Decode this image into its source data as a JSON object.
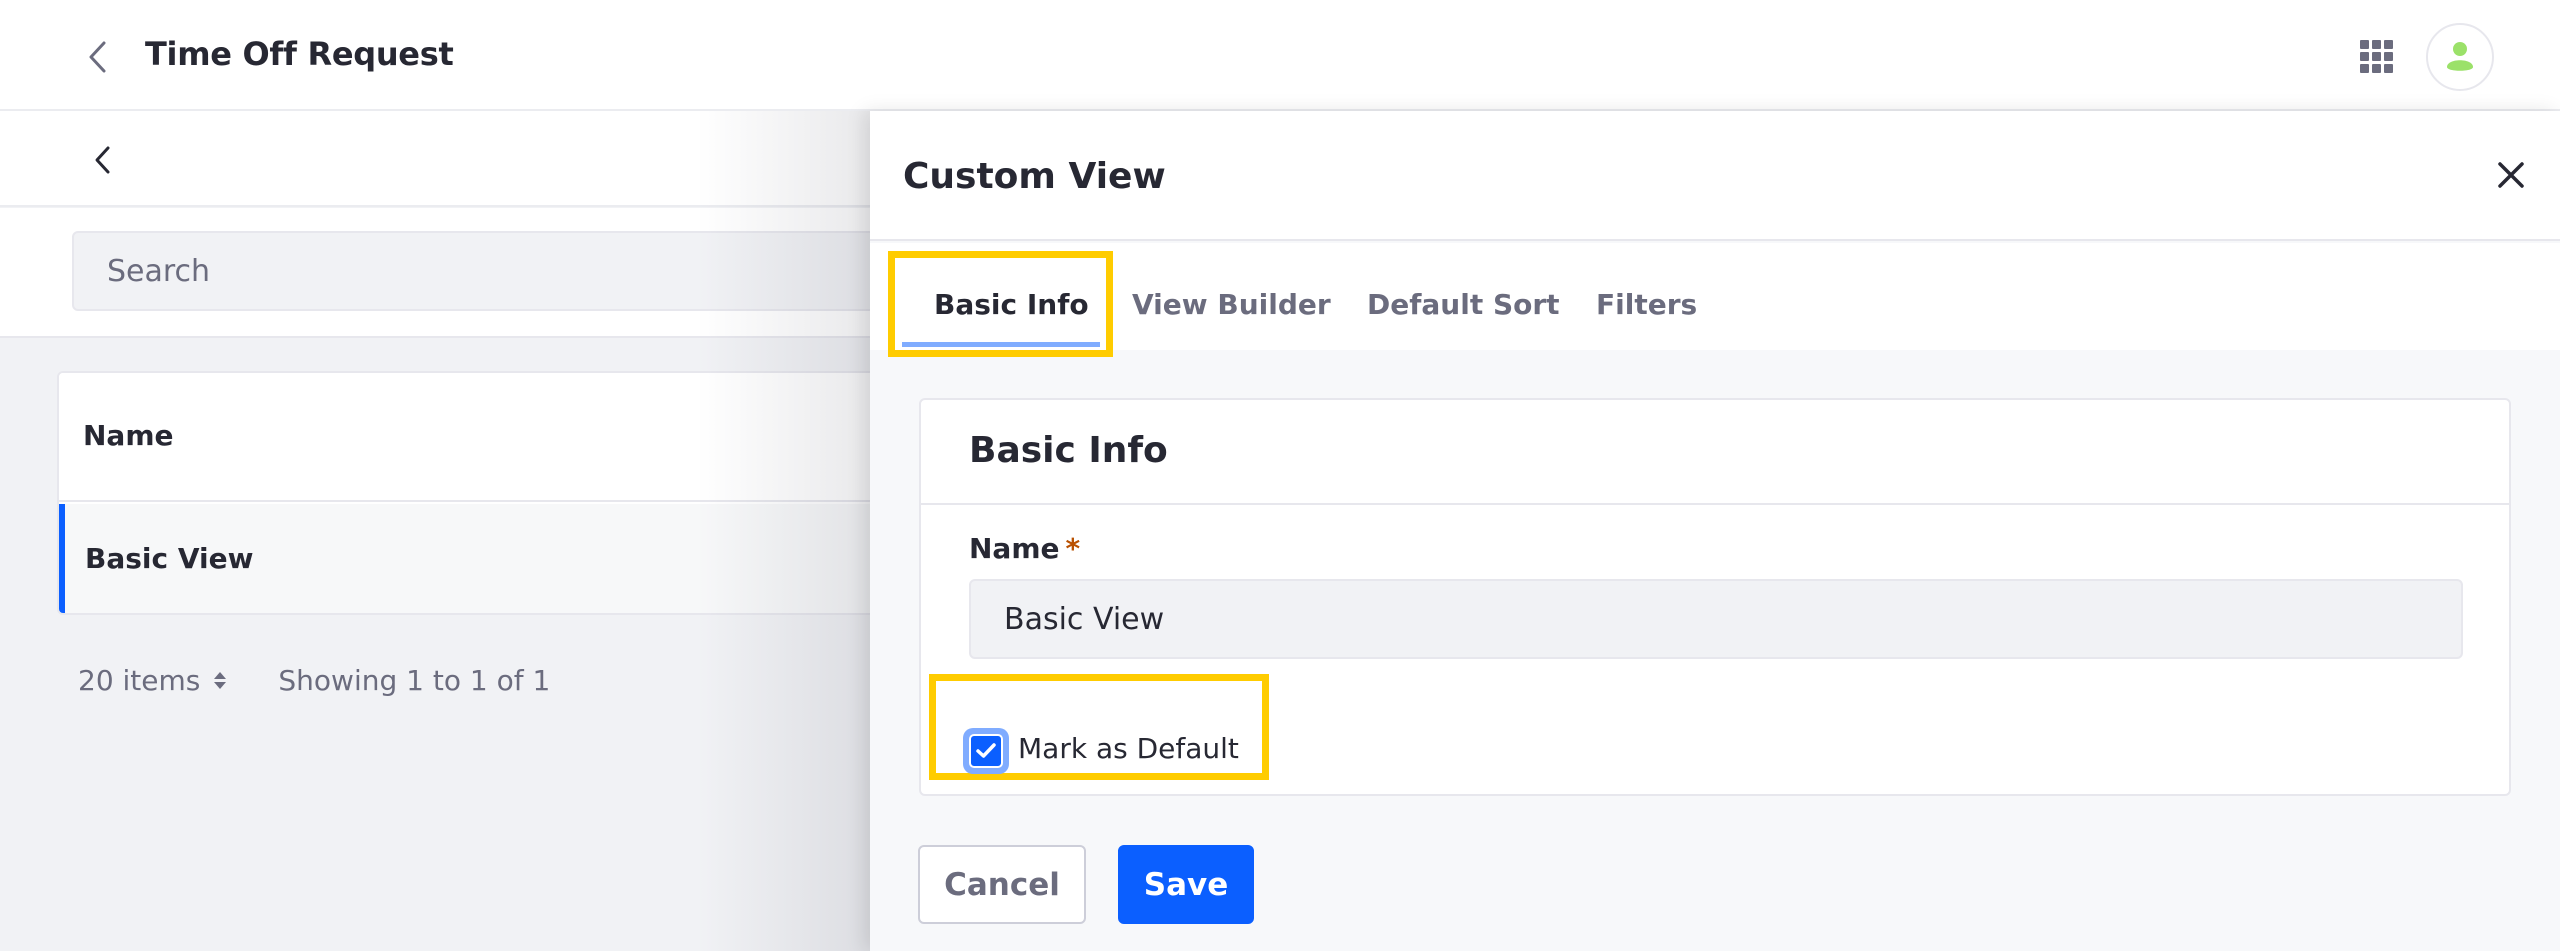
{
  "header": {
    "title": "Time Off Request",
    "back_icon": "chevron-left-icon",
    "apps_icon": "grid-icon",
    "avatar_icon": "user-icon"
  },
  "subbar": {
    "back_icon": "chevron-left-icon"
  },
  "search": {
    "placeholder": "Search"
  },
  "table": {
    "columns": [
      "Name"
    ],
    "rows": [
      {
        "name": "Basic View",
        "selected": true
      }
    ]
  },
  "pagination": {
    "items_per_page": "20 items",
    "showing": "Showing 1 to 1 of 1"
  },
  "panel": {
    "title": "Custom View",
    "close_icon": "close-icon",
    "tabs": [
      {
        "label": "Basic Info",
        "active": true
      },
      {
        "label": "View Builder",
        "active": false
      },
      {
        "label": "Default Sort",
        "active": false
      },
      {
        "label": "Filters",
        "active": false
      }
    ],
    "card": {
      "title": "Basic Info",
      "name_label": "Name",
      "required_mark": "*",
      "name_value": "Basic View",
      "mark_default_label": "Mark as Default",
      "mark_default_checked": true
    },
    "buttons": {
      "cancel": "Cancel",
      "save": "Save"
    }
  },
  "colors": {
    "primary": "#0b5fff",
    "highlight": "#ffcc00",
    "avatar": "#9be169",
    "required": "#b95000"
  }
}
